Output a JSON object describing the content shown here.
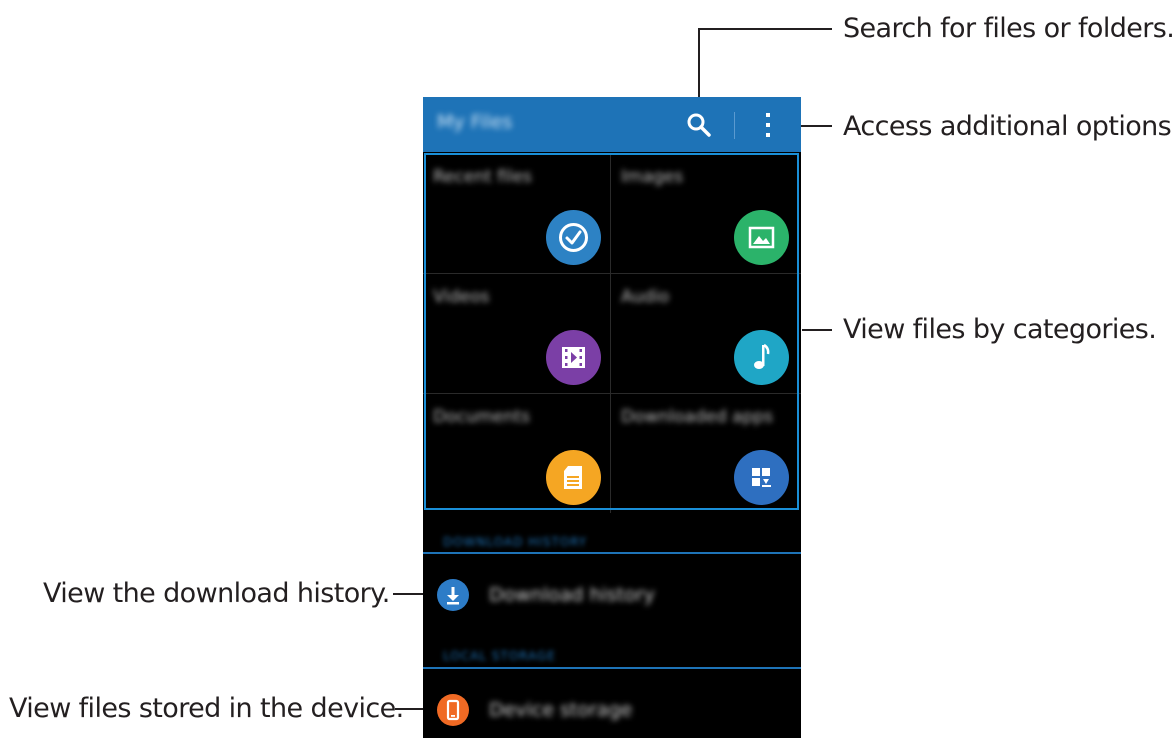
{
  "callouts": {
    "search": "Search for files or folders.",
    "options": "Access additional options.",
    "categories": "View files by categories.",
    "download_history": "View the download history.",
    "device_storage": "View files stored in the device."
  },
  "app": {
    "title": "My Files",
    "accent": "#1e73b7",
    "icons": {
      "search": "search-icon",
      "more": "more-options-icon"
    }
  },
  "categories": [
    {
      "label": "Recent files",
      "icon": "clock-icon",
      "color": "#2d82c4"
    },
    {
      "label": "Images",
      "icon": "image-icon",
      "color": "#2bb36a"
    },
    {
      "label": "Videos",
      "icon": "film-icon",
      "color": "#7b3fa6"
    },
    {
      "label": "Audio",
      "icon": "music-note-icon",
      "color": "#1fa6c6"
    },
    {
      "label": "Documents",
      "icon": "document-icon",
      "color": "#f5a623"
    },
    {
      "label": "Downloaded apps",
      "icon": "apps-download-icon",
      "color": "#2e6fc0"
    }
  ],
  "sections": {
    "download_history_header": "DOWNLOAD HISTORY",
    "download_history_item": "Download history",
    "local_storage_header": "LOCAL STORAGE",
    "device_storage_item": "Device storage"
  },
  "row_colors": {
    "download": "#2d7cc7",
    "device": "#f06a24"
  }
}
